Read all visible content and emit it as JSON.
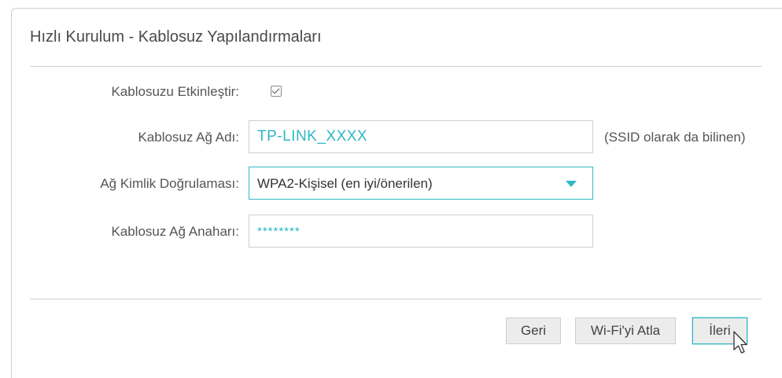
{
  "page": {
    "title": "Hızlı Kurulum - Kablosuz Yapılandırmaları"
  },
  "form": {
    "enable_wireless": {
      "label": "Kablosuzu Etkinleştir:",
      "checked": true
    },
    "ssid": {
      "label": "Kablosuz Ağ Adı:",
      "value": "TP-LINK_XXXX",
      "hint": "(SSID olarak da bilinen)"
    },
    "auth": {
      "label": "Ağ Kimlik Doğrulaması:",
      "selected": "WPA2-Kişisel (en iyi/önerilen)"
    },
    "password": {
      "label": "Kablosuz Ağ Anaharı:",
      "value": "********"
    }
  },
  "buttons": {
    "back": "Geri",
    "skip": "Wi-Fi'yi Atla",
    "next": "İleri"
  },
  "colors": {
    "accent": "#2fb7c5",
    "text": "#555555",
    "button_bg": "#ececec",
    "border": "#cfcfcf"
  },
  "icons": {
    "checkbox": "checkmark-icon",
    "dropdown": "triangle-down-icon",
    "cursor": "mouse-pointer-icon"
  }
}
